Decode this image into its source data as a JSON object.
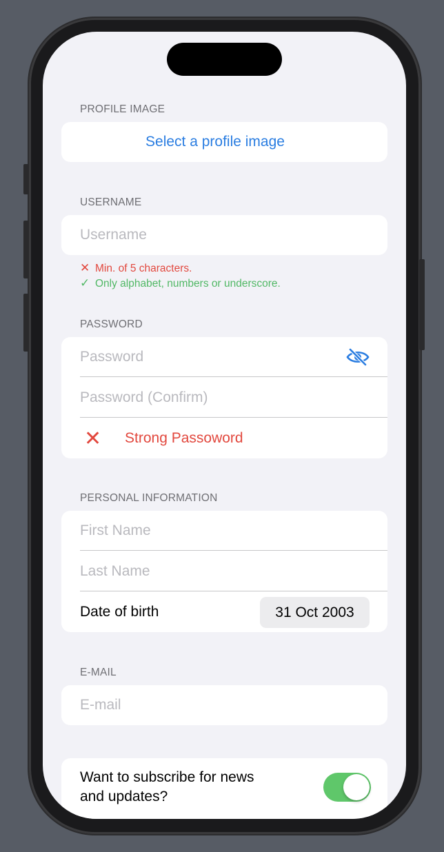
{
  "profile_image": {
    "header": "PROFILE IMAGE",
    "select_label": "Select a profile image"
  },
  "username": {
    "header": "USERNAME",
    "placeholder": "Username",
    "value": "",
    "rules": [
      {
        "status": "invalid",
        "icon": "✕",
        "text": "Min. of 5 characters."
      },
      {
        "status": "valid",
        "icon": "✓",
        "text": "Only alphabet, numbers or underscore."
      }
    ]
  },
  "password": {
    "header": "PASSWORD",
    "placeholder": "Password",
    "confirm_placeholder": "Password (Confirm)",
    "visibility_icon": "eye-slash-icon",
    "strength_icon": "✕",
    "strength_label": "Strong Passoword"
  },
  "personal": {
    "header": "PERSONAL INFORMATION",
    "first_name_placeholder": "First Name",
    "last_name_placeholder": "Last Name",
    "dob_label": "Date of birth",
    "dob_value": "31 Oct 2003"
  },
  "email": {
    "header": "E-MAIL",
    "placeholder": "E-mail"
  },
  "subscribe": {
    "label_line1": "Want to subscribe for news",
    "label_line2": "and updates?",
    "toggle_on": true
  },
  "colors": {
    "accent": "#2a7de1",
    "error": "#e2483e",
    "success": "#51b865",
    "toggle_on": "#5fc76a",
    "background": "#f2f2f7"
  }
}
